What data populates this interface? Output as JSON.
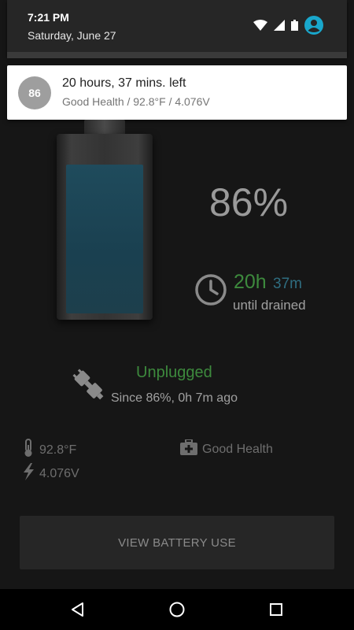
{
  "status_bar": {
    "time": "7:21 PM",
    "date": "Saturday, June 27",
    "icons": [
      "wifi-icon",
      "signal-icon",
      "battery-icon",
      "account-icon"
    ],
    "accent": "#19a7cc"
  },
  "notification": {
    "badge": "86",
    "title": "20 hours, 37 mins. left",
    "subtitle": "Good Health / 92.8°F / 4.076V"
  },
  "battery": {
    "level_percent": 86,
    "percent_label": "86%",
    "fill_color": "#1f4b5c"
  },
  "drain": {
    "hours": "20h",
    "minutes": "37m",
    "label": "until drained",
    "hours_color": "#3d8a3d",
    "minutes_color": "#2f6d80"
  },
  "plug": {
    "status": "Unplugged",
    "since": "Since 86%, 0h 7m ago"
  },
  "stats": {
    "temperature": "92.8°F",
    "voltage": "4.076V",
    "health": "Good Health"
  },
  "actions": {
    "view_battery_use": "VIEW BATTERY USE"
  },
  "nav": {
    "items": [
      "back-icon",
      "home-icon",
      "recents-icon"
    ]
  }
}
